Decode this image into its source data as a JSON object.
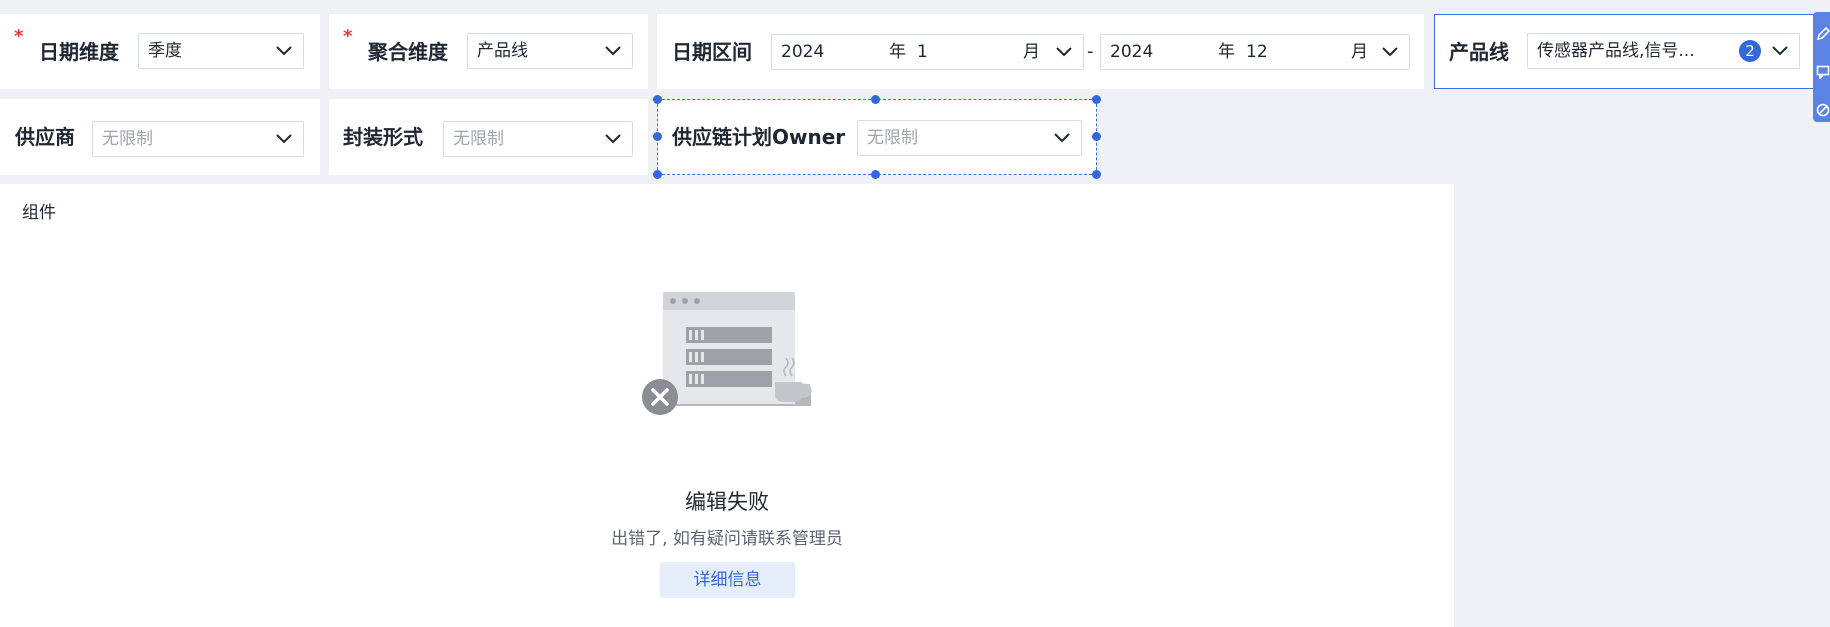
{
  "filters": {
    "date_dimension": {
      "label": "日期维度",
      "value": "季度",
      "required": "*"
    },
    "agg_dimension": {
      "label": "聚合维度",
      "value": "产品线",
      "required": "*"
    },
    "date_range": {
      "label": "日期区间",
      "start_year": "2024",
      "start_year_unit": "年",
      "start_month": "1",
      "start_month_unit": "月",
      "separator": "-",
      "end_year": "2024",
      "end_year_unit": "年",
      "end_month": "12",
      "end_month_unit": "月"
    },
    "product_line": {
      "label": "产品线",
      "value": "传感器产品线,信号...",
      "count": "2"
    },
    "supplier": {
      "label": "供应商",
      "placeholder": "无限制"
    },
    "package_form": {
      "label": "封装形式",
      "placeholder": "无限制"
    },
    "scp_owner": {
      "label": "供应链计划Owner",
      "placeholder": "无限制"
    }
  },
  "panel": {
    "title": "组件",
    "error_title": "编辑失败",
    "error_desc": "出错了, 如有疑问请联系管理员",
    "detail_button": "详细信息"
  },
  "colors": {
    "accent": "#3467d9",
    "required": "#e53935",
    "background": "#f0f1f5"
  }
}
